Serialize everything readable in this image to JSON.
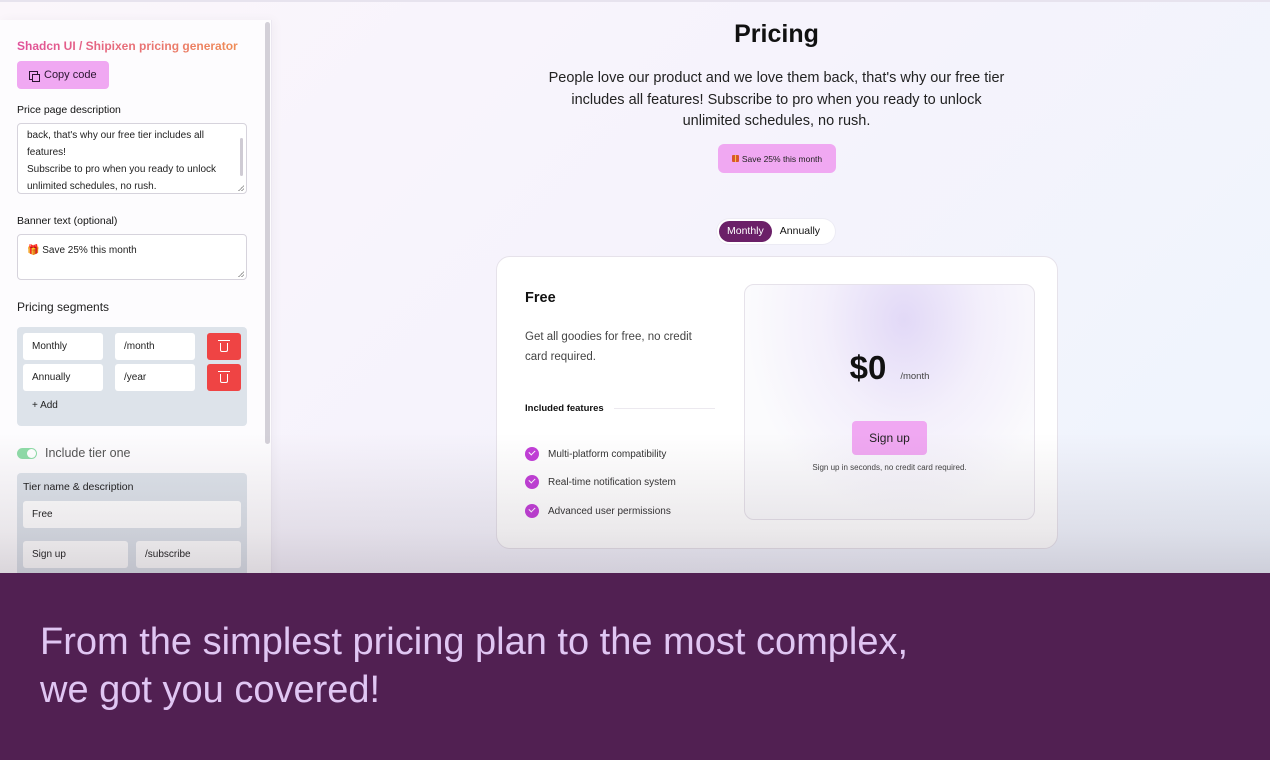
{
  "sidebar": {
    "title": "Shadcn UI / Shipixen pricing generator",
    "copy_label": "Copy code",
    "desc_label": "Price page description",
    "desc_lines": [
      "back, that's why our free tier includes all",
      "features!",
      "Subscribe to pro when you ready to unlock",
      "unlimited schedules, no rush."
    ],
    "banner_label": "Banner text (optional)",
    "banner_value": "🎁 Save 25% this month",
    "segments_heading": "Pricing segments",
    "segments": [
      {
        "name": "Monthly",
        "suffix": "/month"
      },
      {
        "name": "Annually",
        "suffix": "/year"
      }
    ],
    "add_label": "+ Add",
    "include_tier_label": "Include tier one",
    "tier_heading": "Tier name & description",
    "tier_name": "Free",
    "tier_cta": "Sign up",
    "tier_href": "/subscribe"
  },
  "page": {
    "title": "Pricing",
    "description": "People love our product and we love them back, that's why our free tier includes all features! Subscribe to pro when you ready to unlock unlimited schedules, no rush.",
    "banner": "Save 25% this month",
    "switch": [
      "Monthly",
      "Annually"
    ],
    "active_switch": "Monthly"
  },
  "card": {
    "plan": "Free",
    "plan_desc": "Get all goodies for free, no credit card required.",
    "included_label": "Included features",
    "features": [
      "Multi-platform compatibility",
      "Real-time notification system",
      "Advanced user permissions"
    ],
    "price": "$0",
    "period": "/month",
    "cta": "Sign up",
    "note": "Sign up in seconds, no credit card required."
  },
  "footer": {
    "line1": "From the simplest pricing plan to the most complex,",
    "line2": "we got you covered!"
  },
  "colors": {
    "accent_pink": "#f0a8f2",
    "active_purple": "#6b2068",
    "delete_red": "#ef4444",
    "footer_bg": "#512052",
    "footer_text": "#e0c6f3"
  }
}
